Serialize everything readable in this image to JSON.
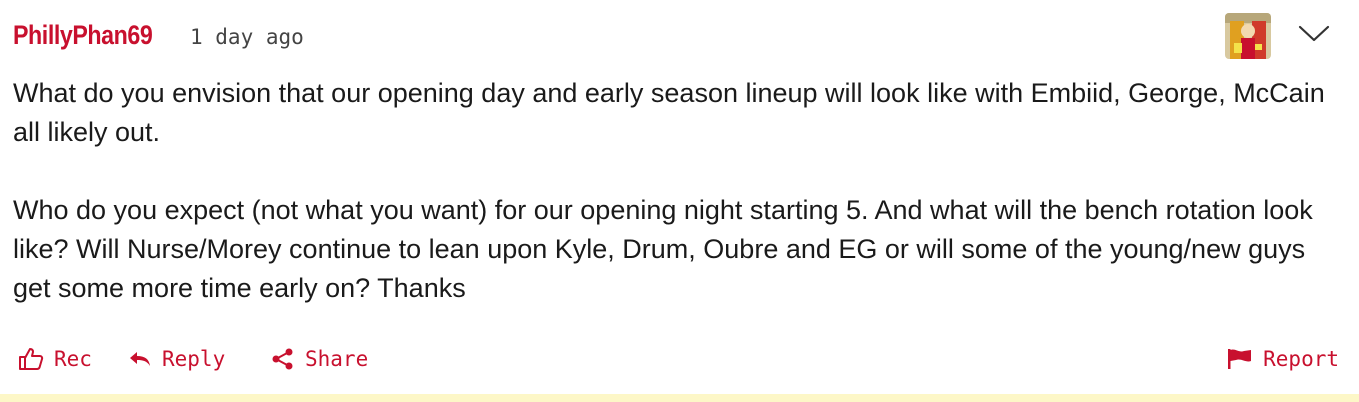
{
  "comment": {
    "username": "PhillyPhan69",
    "timestamp": "1 day ago",
    "avatar_icon": "avatar-image",
    "menu_icon": "chevron-down-icon",
    "paragraphs": [
      "What do you envision that our opening day and early season lineup will look like with Embiid, George, McCain all likely out.",
      "Who do you expect (not what you want) for our opening night starting 5. And what will the bench rotation look like? Will Nurse/Morey continue to lean upon Kyle, Drum, Oubre and EG or will some of the young/new guys get some more time early on? Thanks"
    ]
  },
  "actions": {
    "rec_label": "Rec",
    "reply_label": "Reply",
    "share_label": "Share",
    "report_label": "Report",
    "rec_icon": "thumbs-up-icon",
    "reply_icon": "reply-arrow-icon",
    "share_icon": "share-icon",
    "report_icon": "flag-icon"
  },
  "colors": {
    "accent": "#c8102e",
    "text": "#1a1a1a",
    "muted": "#444444",
    "highlight_bar": "#fdf7c7"
  }
}
